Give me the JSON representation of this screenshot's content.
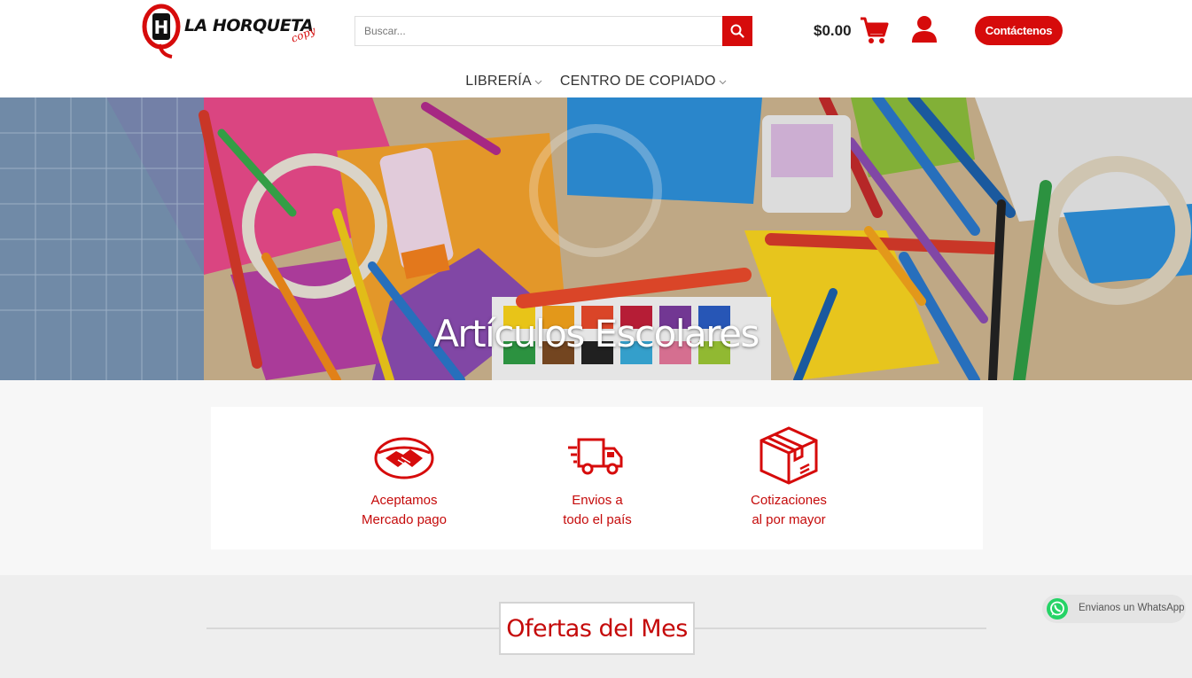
{
  "header": {
    "logo_text": "LA HORQUETA",
    "logo_sub": "copy",
    "logo_letter": "H",
    "search_placeholder": "Buscar...",
    "cart_total": "$0.00",
    "contact_label": "Contáctenos"
  },
  "nav": {
    "items": [
      {
        "label": "LIBRERÍA"
      },
      {
        "label": "CENTRO DE COPIADO"
      }
    ]
  },
  "hero": {
    "title": "Artículos Escolares"
  },
  "features": [
    {
      "line1": "Aceptamos",
      "line2": "Mercado pago",
      "icon": "handshake-icon"
    },
    {
      "line1": "Envios a",
      "line2": "todo el país",
      "icon": "delivery-truck-icon"
    },
    {
      "line1": "Cotizaciones",
      "line2": "al por mayor",
      "icon": "package-box-icon"
    }
  ],
  "offers": {
    "title": "Ofertas del Mes"
  },
  "whatsapp": {
    "label": "Envianos un WhatsApp"
  },
  "colors": {
    "brand_red": "#d60b0b",
    "feature_red": "#c50a0a",
    "whatsapp_green": "#25d366"
  }
}
